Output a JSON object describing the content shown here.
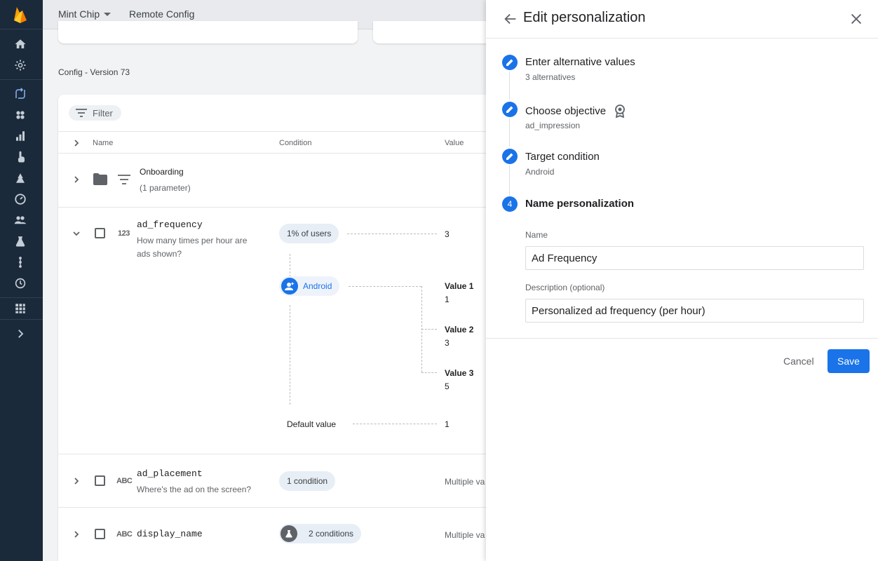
{
  "topbar": {
    "project_name": "Mint Chip",
    "product_name": "Remote Config"
  },
  "config": {
    "version_label": "Config - Version 73"
  },
  "table": {
    "filter_label": "Filter",
    "columns": {
      "name": "Name",
      "condition": "Condition",
      "value": "Value"
    },
    "group": {
      "title": "Onboarding",
      "subtitle": "(1 parameter)"
    },
    "ad_frequency": {
      "key": "ad_frequency",
      "description_line1": "How many times per hour are",
      "description_line2": "ads shown?",
      "type_icon": "123",
      "condition_chip": "1% of users",
      "condition_value": "3",
      "personalization_label": "Android",
      "alternatives": [
        {
          "label": "Value 1",
          "value": "1"
        },
        {
          "label": "Value 2",
          "value": "3"
        },
        {
          "label": "Value 3",
          "value": "5"
        }
      ],
      "default_label": "Default value",
      "default_value": "1"
    },
    "ad_placement": {
      "key": "ad_placement",
      "description": "Where's the ad on the screen?",
      "type_icon": "ABC",
      "condition_chip": "1 condition",
      "value": "Multiple va"
    },
    "display_name": {
      "key": "display_name",
      "type_icon": "ABC",
      "condition_chip": "2 conditions",
      "value": "Multiple va"
    }
  },
  "panel": {
    "title": "Edit personalization",
    "steps": [
      {
        "title": "Enter alternative values",
        "subtitle": "3 alternatives"
      },
      {
        "title": "Choose objective",
        "subtitle": "ad_impression"
      },
      {
        "title": "Target condition",
        "subtitle": "Android"
      },
      {
        "number": "4",
        "title": "Name personalization"
      }
    ],
    "name_label": "Name",
    "name_value": "Ad Frequency",
    "description_label": "Description (optional)",
    "description_value": "Personalized ad frequency (per hour)",
    "cancel_label": "Cancel",
    "save_label": "Save"
  },
  "colors": {
    "accent": "#1a73e8",
    "rail": "#1b2a3a",
    "chip": "#e8eef6"
  },
  "icons": {
    "rail": [
      "firebase-logo",
      "home-icon",
      "settings-icon",
      "remote-config-icon",
      "extensions-icon",
      "analytics-icon",
      "touch-icon",
      "crashlytics-icon",
      "performance-icon",
      "users-icon",
      "testlab-icon",
      "app-distribution-icon",
      "history-icon",
      "apps-icon",
      "expand-icon"
    ]
  }
}
